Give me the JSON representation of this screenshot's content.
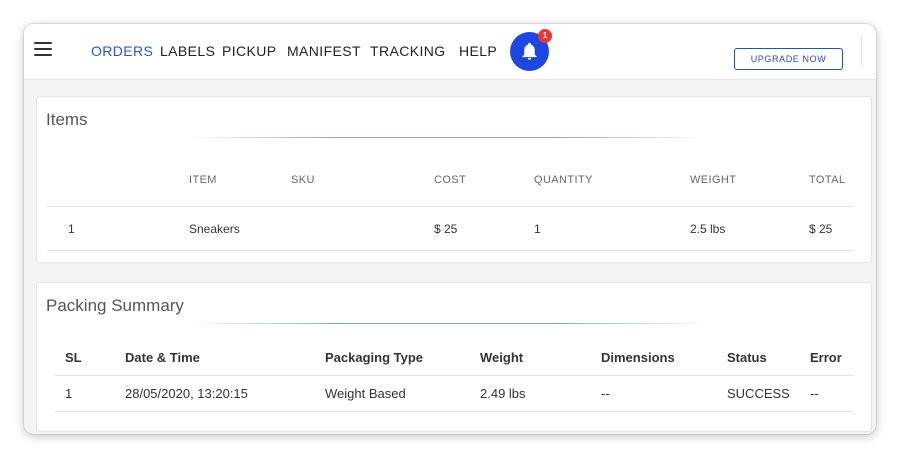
{
  "nav": {
    "items": [
      {
        "label": "ORDERS",
        "active": true
      },
      {
        "label": "LABELS"
      },
      {
        "label": "PICKUP"
      },
      {
        "label": "MANIFEST"
      },
      {
        "label": "TRACKING"
      },
      {
        "label": "HELP"
      }
    ],
    "notification_count": "1",
    "upgrade_label": "UPGRADE NOW"
  },
  "items_section": {
    "title": "Items",
    "columns": [
      "ITEM",
      "SKU",
      "COST",
      "QUANTITY",
      "WEIGHT",
      "TOTAL"
    ],
    "rows": [
      {
        "index": "1",
        "item": "Sneakers",
        "sku": "",
        "cost": "$ 25",
        "quantity": "1",
        "weight": "2.5 lbs",
        "total": "$ 25"
      }
    ]
  },
  "packing_summary": {
    "title": "Packing Summary",
    "columns": [
      "SL",
      "Date & Time",
      "Packaging Type",
      "Weight",
      "Dimensions",
      "Status",
      "Error"
    ],
    "rows": [
      {
        "sl": "1",
        "datetime": "28/05/2020, 13:20:15",
        "packaging_type": "Weight Based",
        "weight": "2.49 lbs",
        "dimensions": "--",
        "status": "SUCCESS",
        "error": "--"
      }
    ]
  },
  "colors": {
    "accent": "#2f55c8",
    "bell": "#1e46e0",
    "badge": "#e53935"
  }
}
